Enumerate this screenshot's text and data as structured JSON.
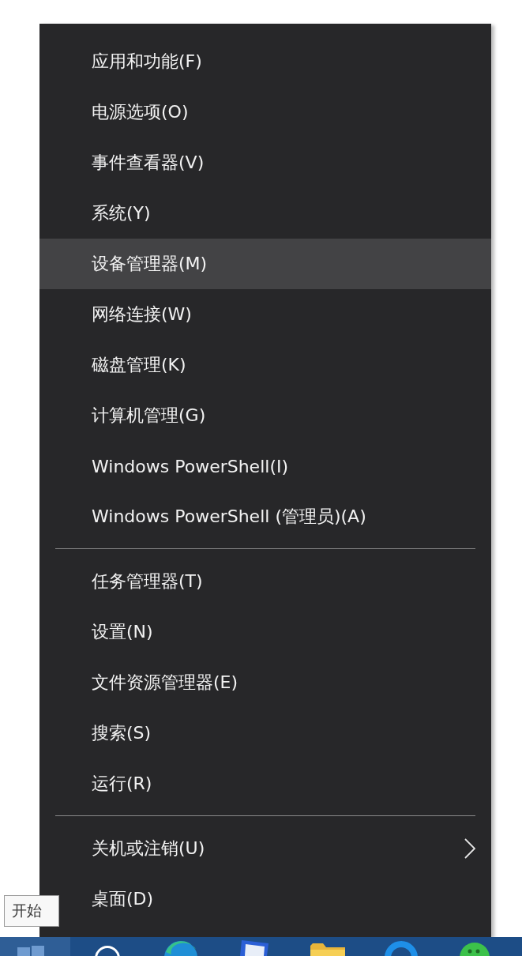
{
  "menu": {
    "groups": [
      {
        "items": [
          {
            "label": "应用和功能(F)",
            "selected": false,
            "has_submenu": false
          },
          {
            "label": "电源选项(O)",
            "selected": false,
            "has_submenu": false
          },
          {
            "label": "事件查看器(V)",
            "selected": false,
            "has_submenu": false
          },
          {
            "label": "系统(Y)",
            "selected": false,
            "has_submenu": false
          },
          {
            "label": "设备管理器(M)",
            "selected": true,
            "has_submenu": false
          },
          {
            "label": "网络连接(W)",
            "selected": false,
            "has_submenu": false
          },
          {
            "label": "磁盘管理(K)",
            "selected": false,
            "has_submenu": false
          },
          {
            "label": "计算机管理(G)",
            "selected": false,
            "has_submenu": false
          },
          {
            "label": "Windows PowerShell(I)",
            "selected": false,
            "has_submenu": false
          },
          {
            "label": "Windows PowerShell (管理员)(A)",
            "selected": false,
            "has_submenu": false
          }
        ]
      },
      {
        "items": [
          {
            "label": "任务管理器(T)",
            "selected": false,
            "has_submenu": false
          },
          {
            "label": "设置(N)",
            "selected": false,
            "has_submenu": false
          },
          {
            "label": "文件资源管理器(E)",
            "selected": false,
            "has_submenu": false
          },
          {
            "label": "搜索(S)",
            "selected": false,
            "has_submenu": false
          },
          {
            "label": "运行(R)",
            "selected": false,
            "has_submenu": false
          }
        ]
      },
      {
        "items": [
          {
            "label": "关机或注销(U)",
            "selected": false,
            "has_submenu": true
          },
          {
            "label": "桌面(D)",
            "selected": false,
            "has_submenu": false
          }
        ]
      }
    ]
  },
  "tooltip": {
    "text": "开始"
  },
  "taskbar": {
    "items": [
      {
        "kind": "start",
        "selected": true
      },
      {
        "kind": "search",
        "selected": false
      },
      {
        "kind": "browser",
        "selected": false
      },
      {
        "kind": "monitor",
        "selected": false
      },
      {
        "kind": "folder",
        "selected": false
      },
      {
        "kind": "ring",
        "selected": false
      },
      {
        "kind": "chat",
        "selected": false
      }
    ]
  }
}
